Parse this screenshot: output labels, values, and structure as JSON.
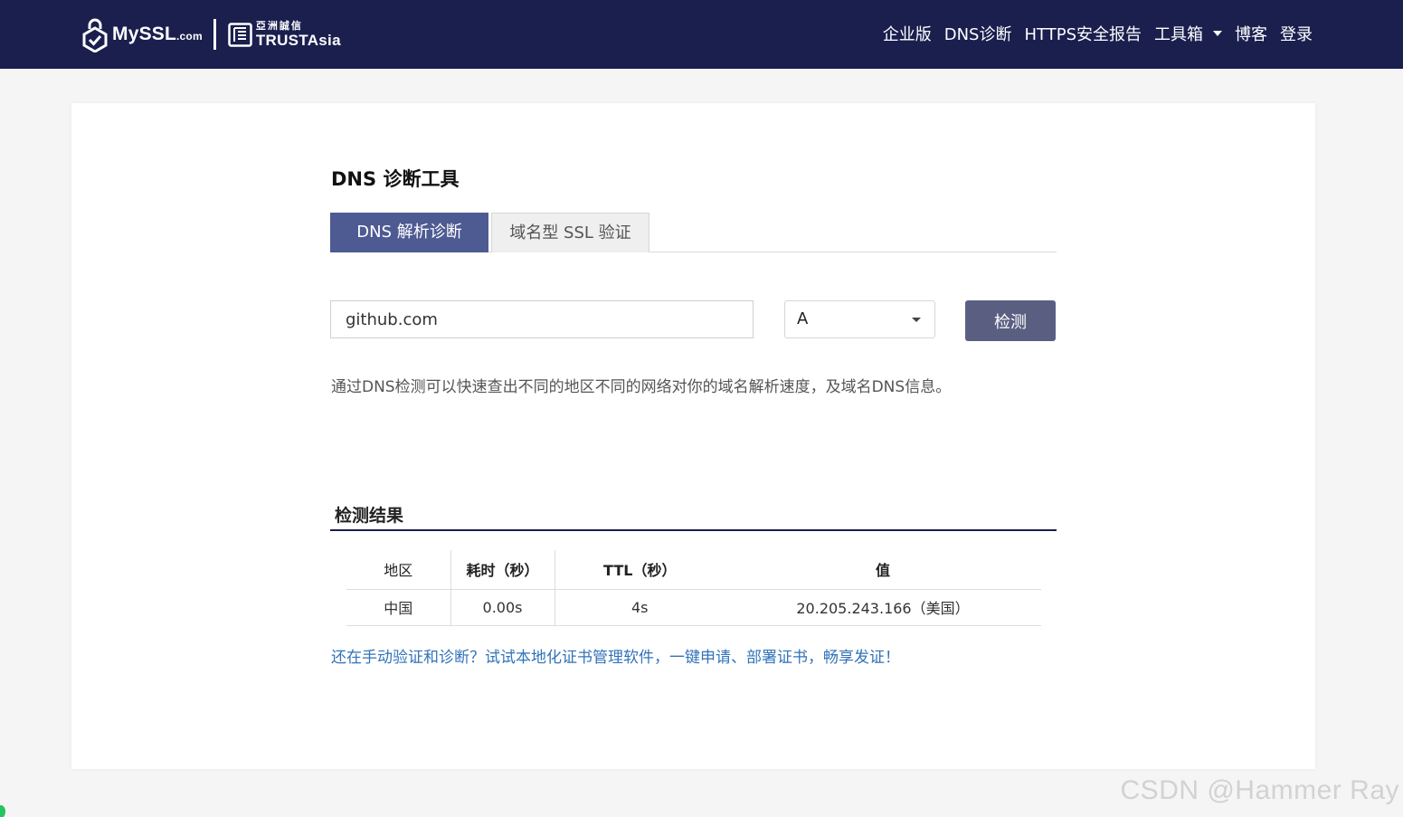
{
  "header": {
    "logo_text": "MySSL",
    "logo_suffix": ".com",
    "partner_cn": "亞洲誠信",
    "partner_en": "TRUSTAsia",
    "nav": [
      {
        "label": "企业版"
      },
      {
        "label": "DNS诊断"
      },
      {
        "label": "HTTPS安全报告"
      },
      {
        "label": "工具箱"
      },
      {
        "label": "博客"
      },
      {
        "label": "登录"
      }
    ]
  },
  "page": {
    "title": "DNS 诊断工具",
    "tabs": [
      {
        "label": "DNS 解析诊断",
        "active": true
      },
      {
        "label": "域名型 SSL 验证",
        "active": false
      }
    ]
  },
  "form": {
    "domain_value": "github.com",
    "record_type": "A",
    "check_label": "检测"
  },
  "description": "通过DNS检测可以快速查出不同的地区不同的网络对你的域名解析速度，及域名DNS信息。",
  "results": {
    "title": "检测结果",
    "headers": [
      "地区",
      "耗时（秒）",
      "TTL（秒）",
      "值"
    ],
    "rows": [
      [
        "中国",
        "0.00s",
        "4s",
        "20.205.243.166（美国）"
      ]
    ]
  },
  "promo": "还在手动验证和诊断？试试本地化证书管理软件，一键申请、部署证书，畅享发证！",
  "watermark": "CSDN @Hammer Ray",
  "colors": {
    "header_bg": "#1a1f4e",
    "tab_active": "#4e5a92",
    "button": "#5a5f82",
    "link": "#3273b8"
  }
}
